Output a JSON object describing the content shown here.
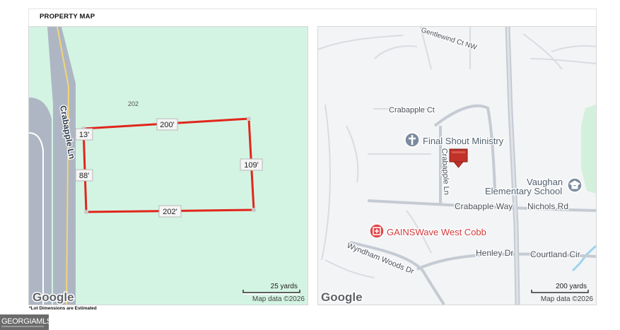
{
  "header": {
    "title": "PROPERTY MAP"
  },
  "lot_map": {
    "parcel_label": "202",
    "street_label": "Crabapple Ln",
    "dimensions": {
      "top": "200'",
      "left_upper": "13'",
      "left_lower": "88'",
      "right": "109'",
      "bottom": "202'"
    },
    "lot_line_color": "#e1261c",
    "scale_label": "25 yards",
    "attribution": "Map data ©2026",
    "google_logo": "Google"
  },
  "area_map": {
    "streets": {
      "gentlewind": "Gentlewind Ct NW",
      "crabapple_ct": "Crabapple Ct",
      "crabapple_ln": "Crabapple Ln",
      "crabapple_way": "Crabapple Way",
      "nichols": "Nichols Rd",
      "wyndham": "Wyndham Woods Dr",
      "henley": "Henley Dr",
      "courtland": "Courtland Cir"
    },
    "pois": {
      "church": "Final Shout Ministry",
      "school_line1": "Vaughan",
      "school_line2": "Elementary School",
      "business": "GAINSWave West Cobb"
    },
    "icons": {
      "church": "church-icon",
      "school": "school-icon",
      "business": "medical-icon",
      "marker": "location-pin-icon"
    },
    "scale_label": "200 yards",
    "attribution": "Map data ©2026",
    "google_logo": "Google"
  },
  "footnote": "*Lot Dimensions are Estimated",
  "logo": {
    "text": "GEORGIAMLS"
  }
}
